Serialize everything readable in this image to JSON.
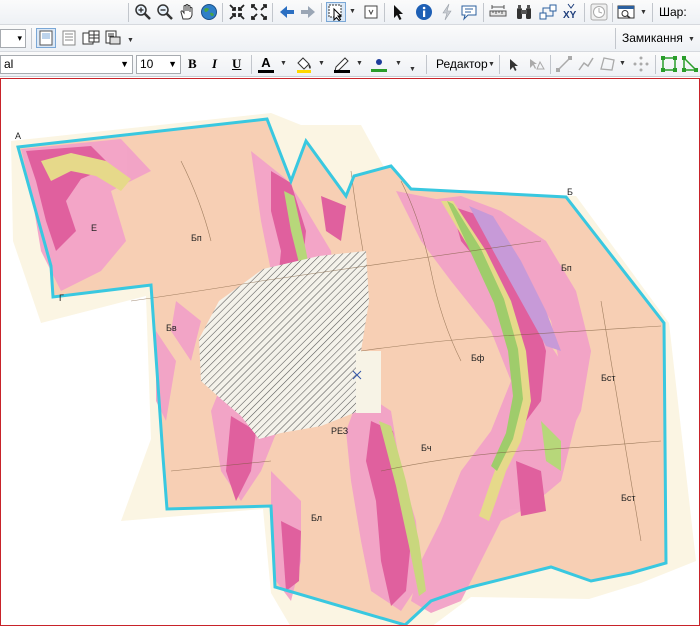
{
  "toolbar1": {
    "scale_label": "Шар:",
    "tools": [
      "zoom-in",
      "zoom-out",
      "pan",
      "full-extent",
      "fixed-zoom-in",
      "fixed-zoom-out",
      "back",
      "forward",
      "select-features",
      "clear-selection",
      "select-elements",
      "identify",
      "hyperlink",
      "html-popup",
      "measure",
      "find",
      "go-to-xy",
      "time-slider",
      "create-viewer-window"
    ]
  },
  "toolbar2": {
    "snapping_label": "Замикання",
    "tools": [
      "layout-view",
      "data-view",
      "table-view",
      "print-preview"
    ]
  },
  "toolbar3": {
    "font_name": "al",
    "font_size": "10",
    "bold_label": "B",
    "italic_label": "I",
    "underline_label": "U",
    "font_color_label": "A",
    "editor_label": "Редактор",
    "colors": {
      "font": "#000000",
      "fill": "#ffd800",
      "line": "#000000",
      "marker": "#2a9d2a"
    }
  },
  "map": {
    "corner_labels": [
      "A",
      "Б",
      "Г"
    ]
  }
}
